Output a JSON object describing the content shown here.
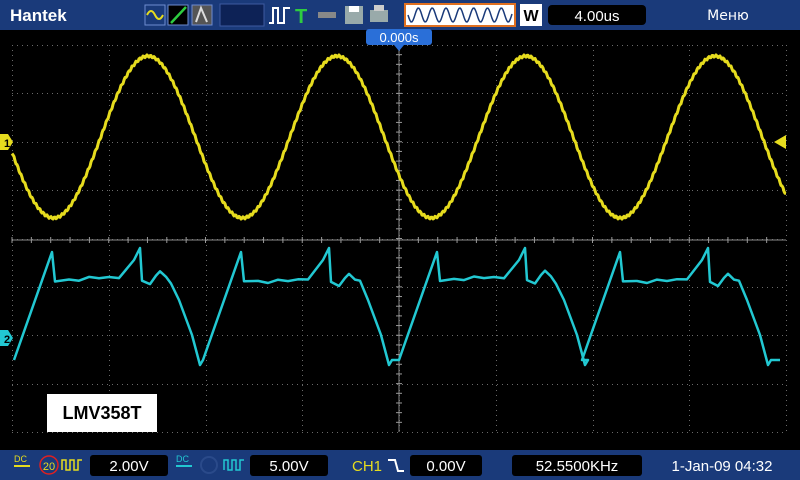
{
  "brand": "Hantek",
  "menu_label": "Меню",
  "trigger": {
    "letter": "T",
    "position_readout": "0.000s"
  },
  "waveform_mode_letter": "W",
  "timebase": "4.00us",
  "overlay_label": "LMV358T",
  "channels": [
    {
      "id": "1",
      "color": "#e6dc1e",
      "coupling": "DC",
      "scale": "2.00V",
      "bw_limit": "20"
    },
    {
      "id": "2",
      "color": "#22c8d2",
      "coupling": "DC",
      "scale": "5.00V"
    }
  ],
  "trigger_source": "CH1",
  "trigger_level": "0.00V",
  "frequency": "52.5500KHz",
  "datetime": "1-Jan-09 04:32",
  "icons": [
    "wave-icon",
    "ramp-icon",
    "cursor-icon",
    "run-stop-icon",
    "trigger-icon",
    "probe-icon",
    "save-icon",
    "print-icon"
  ]
}
